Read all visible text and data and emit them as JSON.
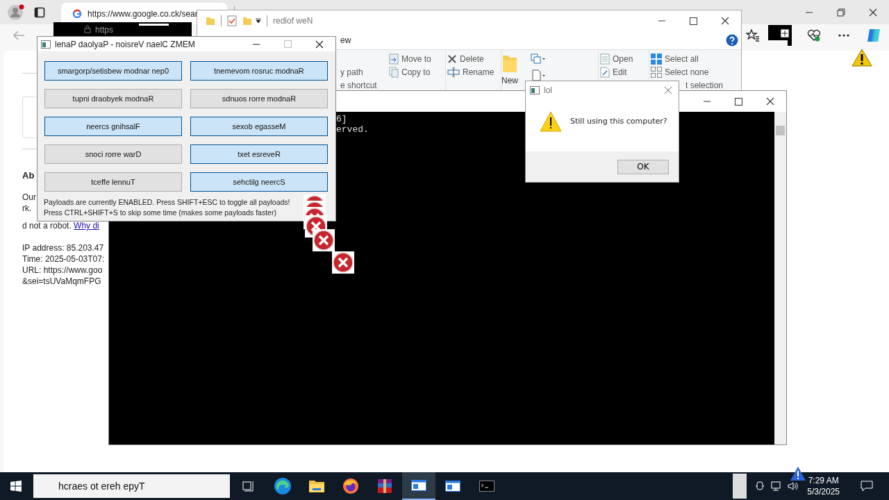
{
  "browser": {
    "tab_title": "https://www.google.co.ck/sear",
    "address_fragment": "https",
    "page": {
      "heading": "Ab",
      "lines": [
        "Our",
        "rk."
      ],
      "robot_line": "d not a robot. ",
      "link": "Why di",
      "info": [
        "IP address: 85.203.47",
        "Time: 2025-05-03T07:",
        "URL: https://www.goo",
        "&sei=tsUVaMqmFPG"
      ]
    }
  },
  "explorer": {
    "title": "redlof weN",
    "tab_fragment": "ew",
    "ribbon": [
      {
        "items": [
          {
            "label": "y path",
            "kind": "text"
          },
          {
            "label": "e shortcut",
            "kind": "text"
          }
        ]
      },
      {
        "items": [
          {
            "label": "Move to",
            "kind": "move"
          },
          {
            "label": "Copy to",
            "kind": "copy"
          }
        ]
      },
      {
        "items": [
          {
            "label": "Delete",
            "kind": "delete"
          },
          {
            "label": "Rename",
            "kind": "rename"
          }
        ]
      },
      {
        "items": [
          {
            "label": "New",
            "kind": "new-folder"
          }
        ]
      },
      {
        "items": [
          {
            "label": "Open",
            "kind": "open"
          },
          {
            "label": "Edit",
            "kind": "edit"
          }
        ]
      },
      {
        "items": [
          {
            "label": "Select all",
            "kind": "select-all"
          },
          {
            "label": "Select none",
            "kind": "select-none"
          },
          {
            "label": "t selection",
            "kind": "text"
          }
        ]
      }
    ]
  },
  "console": {
    "lines": [
      "6]",
      "erved."
    ]
  },
  "memz": {
    "title": "lenaP daolyaP - noisreV naelC ZMEM",
    "payloads": [
      {
        "label": "smargorp/setisbew modnar nep0",
        "on": true
      },
      {
        "label": "tnemevom rosruc modnaR",
        "on": true
      },
      {
        "label": "tupni draobyek modnaR",
        "on": false
      },
      {
        "label": "sdnuos rorre modnaR",
        "on": false
      },
      {
        "label": "neercs gnihsalF",
        "on": true
      },
      {
        "label": "sexob egasseM",
        "on": true
      },
      {
        "label": "snoci rorre warD",
        "on": false
      },
      {
        "label": "txet esreveR",
        "on": true
      },
      {
        "label": "tceffe lennuT",
        "on": false
      },
      {
        "label": "sehctilg neercS",
        "on": true
      }
    ],
    "status": [
      "Payloads are currently ENABLED. Press SHIFT+ESC to toggle all payloads!",
      "Press CTRL+SHIFT+S to skip some time (makes some payloads faster)"
    ]
  },
  "dialog": {
    "title": "lol",
    "message": "Still using this computer?",
    "button": "OK"
  },
  "taskbar": {
    "search_placeholder": "hcraes ot ereh epyT",
    "apps": [
      {
        "kind": "task-view",
        "selected": false
      },
      {
        "kind": "edge",
        "selected": false
      },
      {
        "kind": "folder",
        "selected": false
      },
      {
        "kind": "firefox",
        "selected": false
      },
      {
        "kind": "archive",
        "selected": false
      },
      {
        "kind": "window",
        "selected": true
      },
      {
        "kind": "window",
        "selected": false
      },
      {
        "kind": "terminal",
        "selected": false
      }
    ],
    "time": "7:29 AM",
    "date": "5/3/2025"
  }
}
